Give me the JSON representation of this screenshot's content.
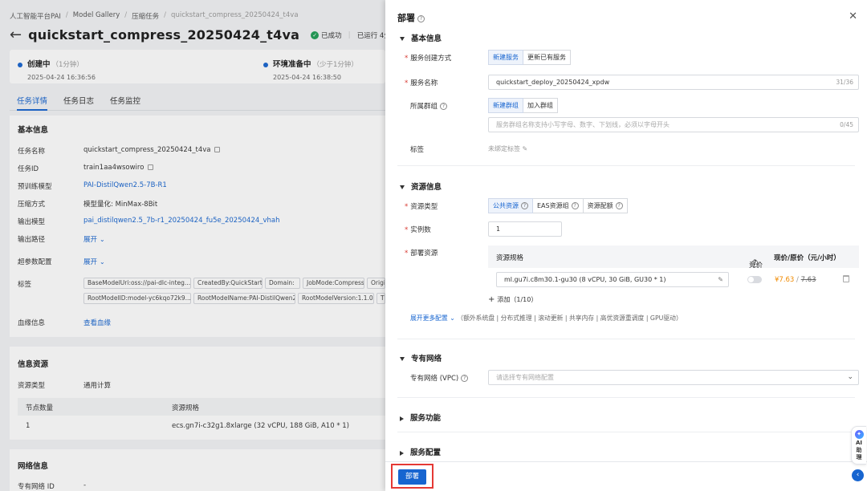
{
  "bg": {
    "breadcrumb": [
      "人工智能平台PAI",
      "Model Gallery",
      "压缩任务",
      "quickstart_compress_20250424_t4va"
    ],
    "title": "quickstart_compress_20250424_t4va",
    "status_ok": "已成功",
    "status_run": "已运行 4分钟",
    "steps": [
      {
        "name": "创建中",
        "duration": "（1分钟）",
        "time": "2025-04-24 16:36:56"
      },
      {
        "name": "环境准备中",
        "duration": "（少于1分钟）",
        "time": "2025-04-24 16:38:50"
      }
    ],
    "tabs": [
      "任务详情",
      "任务日志",
      "任务监控"
    ],
    "basic": {
      "title": "基本信息",
      "rows": [
        {
          "label": "任务名称",
          "value": "quickstart_compress_20250424_t4va"
        },
        {
          "label": "任务ID",
          "value": "train1aa4wsowiro"
        },
        {
          "label": "预训练模型",
          "value": "PAI-DistilQwen2.5-7B-R1"
        },
        {
          "label": "压缩方式",
          "value": "模型量化: MinMax-8Bit"
        },
        {
          "label": "输出模型",
          "value": "pai_distilqwen2.5_7b-r1_20250424_fu5e_20250424_vhah"
        },
        {
          "label": "输出路径",
          "value": "展开"
        },
        {
          "label": "超参数配置",
          "value": "展开"
        },
        {
          "label": "标签",
          "value": ""
        },
        {
          "label": "血缘信息",
          "value": "查看血缘"
        }
      ],
      "tags_row1": [
        "BaseModelUri:oss://pai-dlc-integ...",
        "CreatedBy:QuickStart",
        "Domain:",
        "JobMode:Compress",
        "Origi"
      ],
      "tags_row2": [
        "RootModelID:model-yc6kqo72k9...",
        "RootModelName:PAI-DistilQwen2...",
        "RootModelVersion:1.1.0",
        "T"
      ]
    },
    "resource": {
      "title": "信息资源",
      "type_label": "资源类型",
      "type_value": "通用计算",
      "col1": "节点数量",
      "col2": "资源规格",
      "row_nodes": "1",
      "row_spec": "ecs.gn7i-c32g1.8xlarge (32 vCPU, 188 GiB, A10 * 1)"
    },
    "network": {
      "title": "网络信息",
      "vpc_label": "专有网络 ID",
      "vpc_value": "-"
    }
  },
  "drawer": {
    "title": "部署",
    "sections": {
      "basic": "基本信息",
      "resource": "资源信息",
      "vpc": "专有网络",
      "features": "服务功能",
      "config": "服务配置"
    },
    "create_method_label": "服务创建方式",
    "create_method_options": [
      "新建服务",
      "更新已有服务"
    ],
    "service_name_label": "服务名称",
    "service_name_value": "quickstart_deploy_20250424_xpdw",
    "service_name_count": "31/36",
    "group_label": "所属群组",
    "group_options": [
      "新建群组",
      "加入群组"
    ],
    "group_placeholder": "服务群组名称支持小写字母、数字、下划线，必须以字母开头",
    "group_count": "0/45",
    "tag_label": "标签",
    "tag_value": "未绑定标签",
    "resource_type_label": "资源类型",
    "resource_type_options": [
      "公共资源",
      "EAS资源组",
      "资源配额"
    ],
    "instances_label": "实例数",
    "instances_value": "1",
    "deploy_resource_label": "部署资源",
    "spec_header": "资源规格",
    "bid_header": "竞价",
    "price_header": "现价/原价（元/小时）",
    "spec_value": "ml.gu7i.c8m30.1-gu30 (8 vCPU, 30 GiB, GU30 * 1)",
    "price_now": "¥7.63",
    "price_sep": "/",
    "price_old": "7.63",
    "add_label": "添加（1/10）",
    "more_label": "展开更多配置",
    "more_items": "（额外系统盘 | 分布式推理 | 滚动更新 | 共享内存 | 高优资源重调度 | GPU驱动）",
    "vpc_label": "专有网络 (VPC)",
    "vpc_placeholder": "请选择专有网络配置",
    "deploy_button": "部署",
    "ai_label": "AI助理"
  }
}
